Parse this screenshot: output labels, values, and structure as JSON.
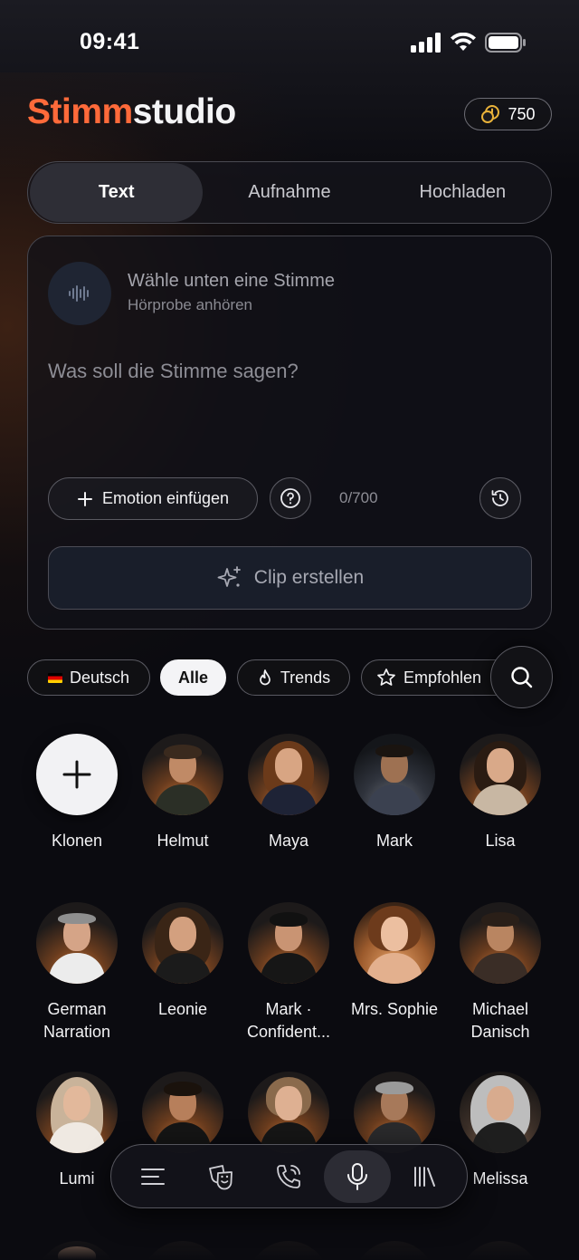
{
  "status": {
    "time": "09:41"
  },
  "header": {
    "brand_part1": "Stimm",
    "brand_part2": "studio",
    "credits": "750"
  },
  "tabs": [
    {
      "label": "Text",
      "active": true
    },
    {
      "label": "Aufnahme",
      "active": false
    },
    {
      "label": "Hochladen",
      "active": false
    }
  ],
  "editor": {
    "voice_title": "Wähle unten eine Stimme",
    "voice_subtitle": "Hörprobe anhören",
    "placeholder": "Was soll die Stimme sagen?",
    "value": "",
    "emotion_label": "Emotion einfügen",
    "counter": "0/700",
    "create_label": "Clip erstellen"
  },
  "filters": [
    {
      "label": "Deutsch",
      "icon": "german-flag-icon",
      "active": false
    },
    {
      "label": "Alle",
      "icon": "",
      "active": true
    },
    {
      "label": "Trends",
      "icon": "flame-icon",
      "active": false
    },
    {
      "label": "Empfohlen",
      "icon": "star-icon",
      "active": false
    }
  ],
  "voices": [
    {
      "name": "Klonen"
    },
    {
      "name": "Helmut"
    },
    {
      "name": "Maya"
    },
    {
      "name": "Mark"
    },
    {
      "name": "Lisa"
    },
    {
      "name": "German Narration"
    },
    {
      "name": "Leonie"
    },
    {
      "name": "Mark · Confident..."
    },
    {
      "name": "Mrs. Sophie"
    },
    {
      "name": "Michael Danisch"
    },
    {
      "name": "Lumi"
    },
    {
      "name": ""
    },
    {
      "name": ""
    },
    {
      "name": ""
    },
    {
      "name": "Melissa"
    }
  ],
  "nav": [
    {
      "icon": "menu-lines-icon",
      "active": false
    },
    {
      "icon": "theater-masks-icon",
      "active": false
    },
    {
      "icon": "phone-call-icon",
      "active": false
    },
    {
      "icon": "microphone-icon",
      "active": true
    },
    {
      "icon": "library-icon",
      "active": false
    }
  ],
  "colors": {
    "accent": "#ff6a3a",
    "background": "#0b0b10"
  }
}
